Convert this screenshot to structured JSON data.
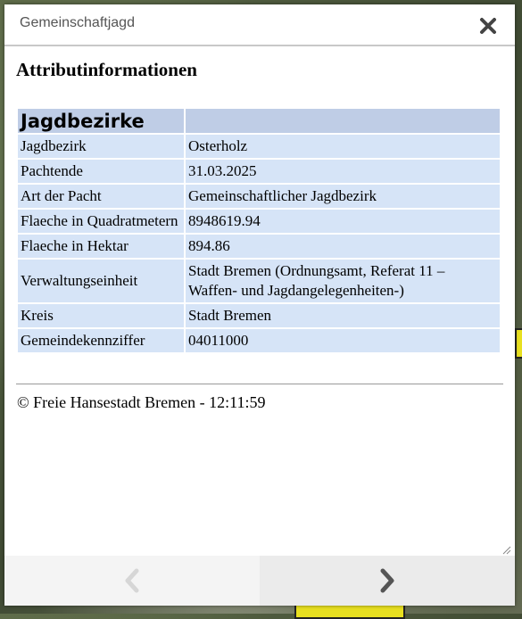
{
  "popup": {
    "title": "Gemeinschaftjagd"
  },
  "content": {
    "heading": "Attributinformationen",
    "table": {
      "header": "Jagdbezirke",
      "rows": [
        {
          "key": "Jagdbezirk",
          "value": "Osterholz"
        },
        {
          "key": "Pachtende",
          "value": "31.03.2025"
        },
        {
          "key": "Art der Pacht",
          "value": "Gemeinschaftlicher Jagdbezirk"
        },
        {
          "key": "Flaeche in Quadratmetern",
          "value": "8948619.94"
        },
        {
          "key": "Flaeche in Hektar",
          "value": "894.86"
        },
        {
          "key": "Verwaltungseinheit",
          "value": "Stadt Bremen (Ordnungsamt, Referat 11 – Waffen- und Jagdangelegenheiten-)"
        },
        {
          "key": "Kreis",
          "value": "Stadt Bremen"
        },
        {
          "key": "Gemeindekennziffer",
          "value": "04011000"
        }
      ]
    },
    "copyright": "© Freie Hansestadt Bremen - 12:11:59"
  },
  "nav": {
    "prev_icon": "chevron-left-icon",
    "next_icon": "chevron-right-icon",
    "prev_enabled": false,
    "next_enabled": true
  },
  "colors": {
    "table_header": "#bfcde6",
    "table_cell": "#d6e4f7",
    "highlight": "#e8e020"
  }
}
